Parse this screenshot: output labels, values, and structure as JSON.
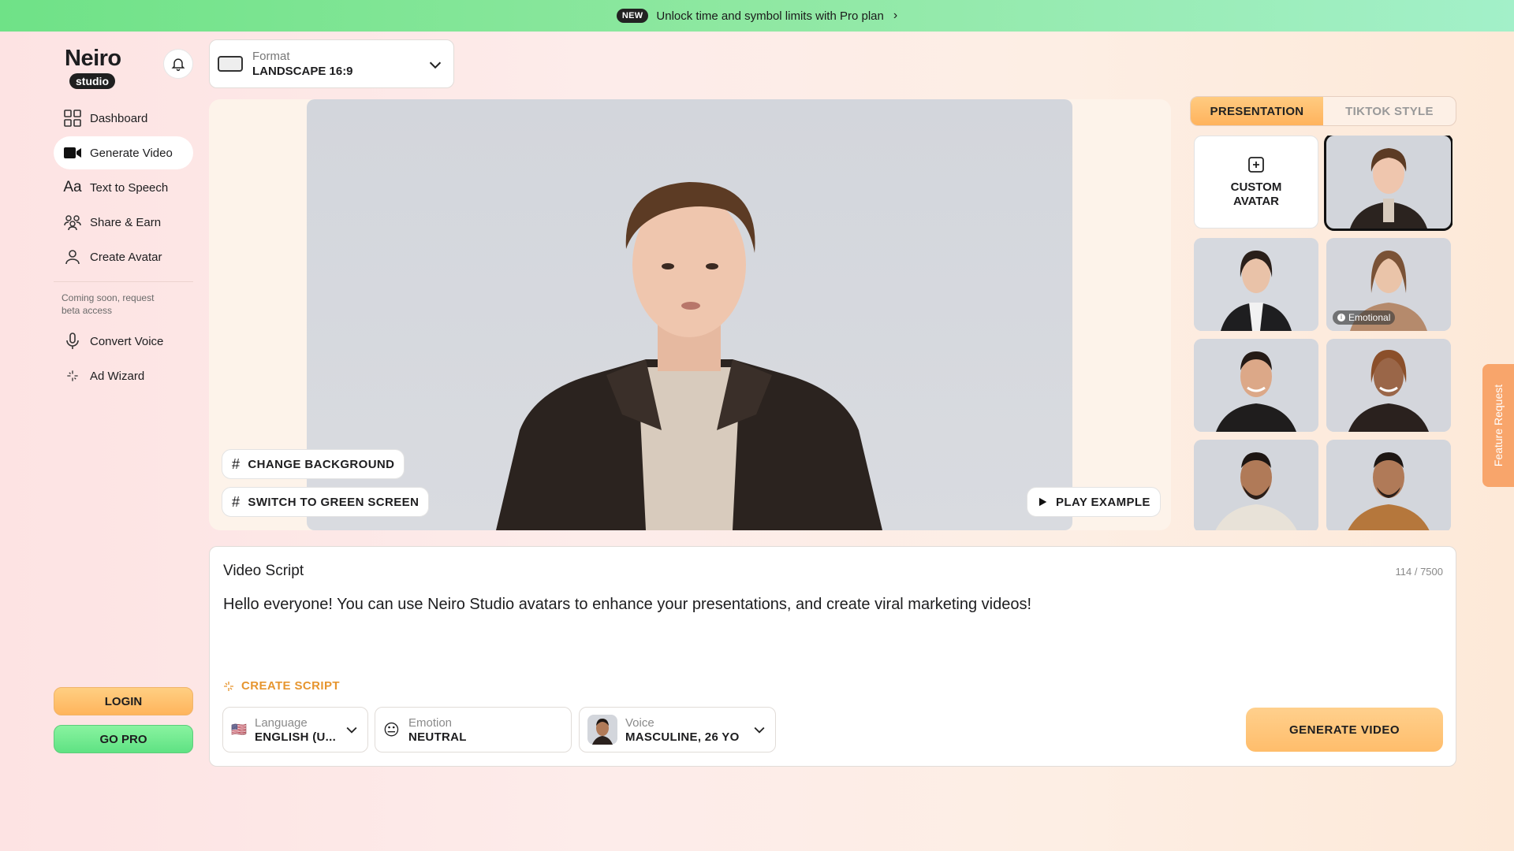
{
  "banner": {
    "badge": "NEW",
    "text": "Unlock time and symbol limits with Pro plan",
    "chevron": "›"
  },
  "logo": {
    "word": "Neiro",
    "pill": "studio"
  },
  "nav": {
    "items": [
      {
        "label": "Dashboard",
        "icon": "grid-icon"
      },
      {
        "label": "Generate Video",
        "icon": "video-camera-icon",
        "active": true
      },
      {
        "label": "Text to Speech",
        "icon": "text-aa-icon"
      },
      {
        "label": "Share & Earn",
        "icon": "people-icon"
      },
      {
        "label": "Create Avatar",
        "icon": "person-icon"
      }
    ],
    "note": "Coming soon, request beta access",
    "beta_items": [
      {
        "label": "Convert Voice",
        "icon": "microphone-icon"
      },
      {
        "label": "Ad Wizard",
        "icon": "sparkle-icon"
      }
    ]
  },
  "auth": {
    "login": "LOGIN",
    "go_pro": "GO PRO"
  },
  "format": {
    "label": "Format",
    "value": "LANDSCAPE 16:9"
  },
  "preview": {
    "change_bg": "CHANGE BACKGROUND",
    "green_screen": "SWITCH TO GREEN SCREEN",
    "play_example": "PLAY EXAMPLE"
  },
  "avatar_tabs": {
    "active": "PRESENTATION",
    "inactive": "TIKTOK STYLE"
  },
  "avatars": {
    "custom_label": "CUSTOM\nAVATAR",
    "emotional_badge": "Emotional"
  },
  "feature_request": "Feature Request",
  "script": {
    "title": "Video Script",
    "count": "114 / 7500",
    "text": "Hello everyone! You can use Neiro Studio avatars to enhance your presentations, and create viral marketing videos!",
    "create_script": "CREATE SCRIPT"
  },
  "controls": {
    "language": {
      "label": "Language",
      "value": "ENGLISH (U...",
      "flag": "🇺🇸"
    },
    "emotion": {
      "label": "Emotion",
      "value": "NEUTRAL",
      "emoji": "😐"
    },
    "voice": {
      "label": "Voice",
      "value": "MASCULINE, 26 YO"
    }
  },
  "generate": "GENERATE VIDEO",
  "colors": {
    "accent_orange": "#ffb45c",
    "accent_green": "#5fe283",
    "link_orange": "#e6952f"
  }
}
